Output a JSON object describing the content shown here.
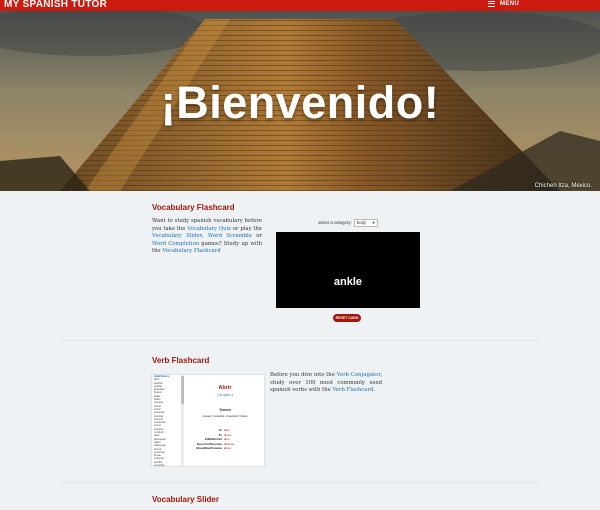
{
  "header": {
    "brand": "MY SPANISH TUTOR",
    "menu_label": "MENU"
  },
  "hero": {
    "title": "¡Bienvenido!",
    "caption": "Chichen Itza, Mexico."
  },
  "sections": {
    "vocab_flashcard": {
      "title": "Vocabulary Flashcard",
      "p1": "Want to study spanish vocabulary before you take the ",
      "link_quiz": "Vocabulary Quiz",
      "p2": " or play the ",
      "link_slider": "Vocabulary Slider",
      "p3": ", ",
      "link_scramble": "Word Scramble",
      "p4": " or ",
      "link_completion": "Word Completion",
      "p5": " games? Study up with the ",
      "link_flashcard": "Vocabulary Flashcard",
      "select_label": "select a category:",
      "select_value": "body",
      "card_word": "ankle",
      "reset_label": "RESET CARD"
    },
    "verb_flashcard": {
      "title": "Verb Flashcard",
      "p1": "Before you dive into the ",
      "link_conjugator": "Verb Conjugator",
      "p2": ", study over 100 most commonly used spanish verbs with the ",
      "link_flashcard": "Verb Flashcard",
      "p3": ".",
      "thumb": {
        "list_header": "Indefinitives",
        "verbs": [
          "abrir",
          "aceptar",
          "ayudar",
          "aprender",
          "buscar",
          "bailar",
          "beber",
          "caminar",
          "comer",
          "cerrar",
          "contestar",
          "comprar",
          "conocer",
          "comenzar",
          "correr",
          "cambiar",
          "conducir",
          "decir",
          "descansar",
          "deber",
          "desayunar",
          "dormir",
          "encontrar",
          "enviar",
          "empezar",
          "escribir",
          "escuchar",
          "esperar",
          "estudiar",
          "entrar",
          "hablar",
          "hacer"
        ],
        "verb": "Abrir",
        "meaning": "[ to open ]",
        "tenses_title": "Tenses",
        "tenses": "present | preterite | imperfect | future",
        "conjugations": [
          {
            "p": "Yo",
            "f": "abro"
          },
          {
            "p": "Tú",
            "f": "abres"
          },
          {
            "p": "Él/Ella/Usted",
            "f": "abre"
          },
          {
            "p": "Nosotros/Nosotras",
            "f": "abrimos"
          },
          {
            "p": "Ellos/Ellas/Ustedes",
            "f": "abren"
          }
        ]
      }
    },
    "vocab_slider": {
      "title": "Vocabulary Slider"
    }
  },
  "colors": {
    "brand_red": "#cc1a0e",
    "accent_red": "#a5160a",
    "link_blue": "#1a6fb8",
    "background": "#eef2f4"
  }
}
